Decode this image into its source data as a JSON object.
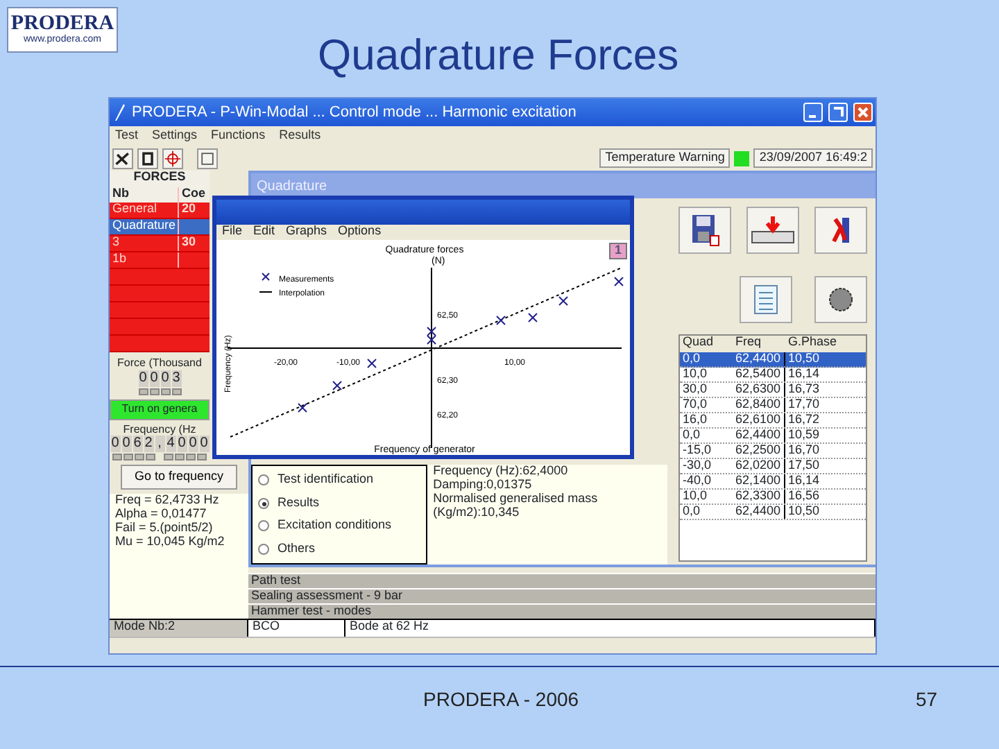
{
  "logo": {
    "name": "PRODERA",
    "url": "www.prodera.com"
  },
  "slide": {
    "title": "Quadrature Forces",
    "footer": "PRODERA - 2006",
    "page_number": "57"
  },
  "app": {
    "title": "PRODERA - P-Win-Modal ... Control mode ... Harmonic excitation",
    "menu": [
      "Test",
      "Settings",
      "Functions",
      "Results"
    ],
    "temperature_warning": {
      "label": "Temperature Warning",
      "on": true
    },
    "datetime": "23/09/2007 16:49:2",
    "forces": {
      "title": "FORCES",
      "columns": [
        "Nb",
        "Coe"
      ],
      "rows": [
        {
          "name": "General",
          "value": "20",
          "selected": false
        },
        {
          "name": "Quadrature",
          "selected": true
        },
        {
          "name": "3",
          "value": "30",
          "selected": false
        },
        {
          "name": "1b",
          "selected": false
        }
      ]
    },
    "force_label": "Force (Thousand",
    "force_digits": [
      "0",
      "0",
      "0",
      "3"
    ],
    "generator_button": "Turn on genera",
    "frequency_label": "Frequency (Hz",
    "frequency_digits": [
      "0",
      "0",
      "6",
      "2",
      ",",
      "4",
      "0",
      "0",
      "0"
    ],
    "goto_button": "Go to frequency",
    "results": [
      "Freq = 62,4733 Hz",
      "Alpha = 0,01477",
      "Fail = 5.(point5/2)",
      "Mu = 10,045 Kg/m2"
    ],
    "log_rows": [
      "Path test",
      "Sealing assessment - 9 bar",
      "Hammer test - modes"
    ],
    "status": [
      "Mode Nb:2",
      "BCO",
      "Bode at 62 Hz"
    ]
  },
  "quadrature_window": {
    "title": "Quadrature",
    "graph": {
      "menu": [
        "File",
        "Edit",
        "Graphs",
        "Options"
      ],
      "badge": "1",
      "title": "Quadrature forces",
      "unit": "(N)",
      "ylabel": "Frequency (Hz)",
      "xlabel": "Frequency of generator",
      "legend": [
        {
          "label": "Measurements",
          "kind": "marker"
        },
        {
          "label": "Interpolation",
          "kind": "line"
        }
      ],
      "xtick_labels": [
        "-20,00",
        "-10,00",
        "10,00"
      ],
      "ytick_labels": [
        "62,50",
        "62,30",
        "62,20"
      ]
    },
    "options": [
      {
        "label": "Test identification",
        "selected": false
      },
      {
        "label": "Results",
        "selected": true
      },
      {
        "label": "Excitation conditions",
        "selected": false
      },
      {
        "label": "Others",
        "selected": false
      }
    ],
    "info": [
      "Frequency (Hz):62,4000",
      "Damping:0,01375",
      "Normalised generalised mass (Kg/m2):10,345"
    ],
    "table": {
      "columns": [
        "Quad",
        "Freq",
        "G.Phase"
      ],
      "rows": [
        {
          "cells": [
            "0,0",
            "62,4400",
            "10,50"
          ],
          "selected": true
        },
        {
          "cells": [
            "10,0",
            "62,5400",
            "16,14"
          ],
          "selected": false
        },
        {
          "cells": [
            "30,0",
            "62,6300",
            "16,73"
          ],
          "selected": false
        },
        {
          "cells": [
            "70,0",
            "62,8400",
            "17,70"
          ],
          "selected": false
        },
        {
          "cells": [
            "16,0",
            "62,6100",
            "16,72"
          ],
          "selected": false
        },
        {
          "cells": [
            "0,0",
            "62,4400",
            "10,59"
          ],
          "selected": false
        },
        {
          "cells": [
            "-15,0",
            "62,2500",
            "16,70"
          ],
          "selected": false
        },
        {
          "cells": [
            "-30,0",
            "62,0200",
            "17,50"
          ],
          "selected": false
        },
        {
          "cells": [
            "-40,0",
            "62,1400",
            "16,14"
          ],
          "selected": false
        },
        {
          "cells": [
            "10,0",
            "62,3300",
            "16,56"
          ],
          "selected": false
        },
        {
          "cells": [
            "0,0",
            "62,4400",
            "10,50"
          ],
          "selected": false
        }
      ]
    }
  }
}
